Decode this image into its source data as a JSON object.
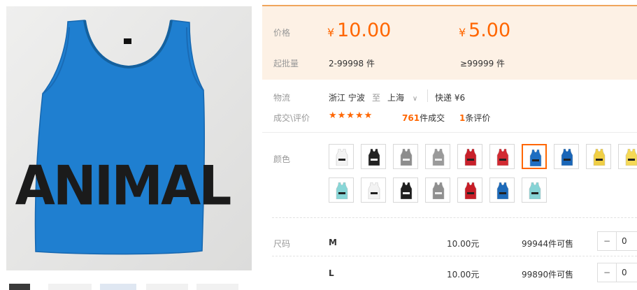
{
  "pricing": {
    "price_label": "价格",
    "moq_label": "起批量",
    "currency": "¥",
    "tiers": [
      {
        "price": "10.00",
        "range": "2-99998 件"
      },
      {
        "price": "5.00",
        "range": "≥99999 件"
      }
    ]
  },
  "shipping": {
    "label": "物流",
    "from": "浙江 宁波",
    "to_word": "至",
    "dest": "上海",
    "method": "快递 ¥6"
  },
  "deals": {
    "label": "成交\\评价",
    "stars": "★★★★★",
    "sold_count": "761",
    "sold_text": "件成交",
    "review_count": "1",
    "review_text": "条评价"
  },
  "colors": {
    "label": "颜色",
    "selected_index": 6,
    "swatches": [
      {
        "name": "white",
        "hex": "#f3f3f3"
      },
      {
        "name": "black",
        "hex": "#222222"
      },
      {
        "name": "grey",
        "hex": "#8d8d8d"
      },
      {
        "name": "grey-2",
        "hex": "#9a9a9a"
      },
      {
        "name": "red",
        "hex": "#c8202a"
      },
      {
        "name": "red-2",
        "hex": "#d22a32"
      },
      {
        "name": "blue",
        "hex": "#1f6ec2"
      },
      {
        "name": "blue-2",
        "hex": "#1a66b8"
      },
      {
        "name": "yellow",
        "hex": "#f0cf45"
      },
      {
        "name": "yellow-2",
        "hex": "#f5d957"
      },
      {
        "name": "aqua",
        "hex": "#88d6d7"
      },
      {
        "name": "white-yellow",
        "hex": "#f3f3f3"
      },
      {
        "name": "black-yellow",
        "hex": "#1e1e1e"
      },
      {
        "name": "grey-3",
        "hex": "#8f8f8f"
      },
      {
        "name": "red-3",
        "hex": "#c71d27"
      },
      {
        "name": "blue-3",
        "hex": "#1d6ab9"
      },
      {
        "name": "aqua-2",
        "hex": "#86d3d5"
      }
    ]
  },
  "sizes": {
    "label": "尺码",
    "rows": [
      {
        "name": "M",
        "price": "10.00元",
        "stock": "99944件可售",
        "qty": "0"
      },
      {
        "name": "L",
        "price": "10.00元",
        "stock": "99890件可售",
        "qty": "0"
      }
    ]
  },
  "product_image": {
    "garment_color": "#1f7fd0",
    "print_text": "ANIMAL"
  }
}
